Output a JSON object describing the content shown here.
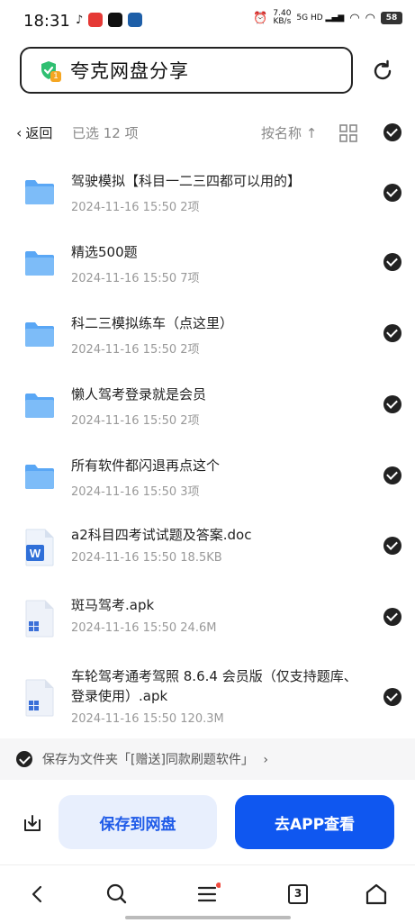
{
  "status_bar": {
    "time": "18:31",
    "speed_value": "7.40",
    "speed_unit": "KB/s",
    "network": "5G HD",
    "battery": "58"
  },
  "header": {
    "search_text": "夸克网盘分享",
    "shield_badge": "1"
  },
  "toolbar": {
    "back_label": "返回",
    "selected_text": "已选 12 项",
    "sort_label": "按名称"
  },
  "files": [
    {
      "name": "驾驶模拟【科目一二三四都可以用的】",
      "meta": "2024-11-16 15:50   2项",
      "icon": "folder-icon"
    },
    {
      "name": "精选500题",
      "meta": "2024-11-16 15:50   7项",
      "icon": "folder-icon"
    },
    {
      "name": "科二三模拟练车（点这里）",
      "meta": "2024-11-16 15:50   2项",
      "icon": "folder-icon"
    },
    {
      "name": "懒人驾考登录就是会员",
      "meta": "2024-11-16 15:50   2项",
      "icon": "folder-icon"
    },
    {
      "name": "所有软件都闪退再点这个",
      "meta": "2024-11-16 15:50   3项",
      "icon": "folder-icon"
    },
    {
      "name": "a2科目四考试试题及答案.doc",
      "meta": "2024-11-16 15:50   18.5KB",
      "icon": "word-doc-icon"
    },
    {
      "name": "斑马驾考.apk",
      "meta": "2024-11-16 15:50   24.6M",
      "icon": "apk-icon"
    },
    {
      "name": "车轮驾考通考驾照 8.6.4 会员版（仅支持题库、登录使用）.apk",
      "meta": "2024-11-16 15:50   120.3M",
      "icon": "apk-icon"
    }
  ],
  "save_folder": {
    "text": "保存为文件夹「[赠送]同款刷题软件」",
    "chevron": "›"
  },
  "actions": {
    "save_label": "保存到网盘",
    "open_app_label": "去APP查看"
  },
  "nav": {
    "tabs_count": "3"
  },
  "colors": {
    "accent": "#0f57f0",
    "folder": "#5aa7f5",
    "save_bg": "#e8effd"
  }
}
